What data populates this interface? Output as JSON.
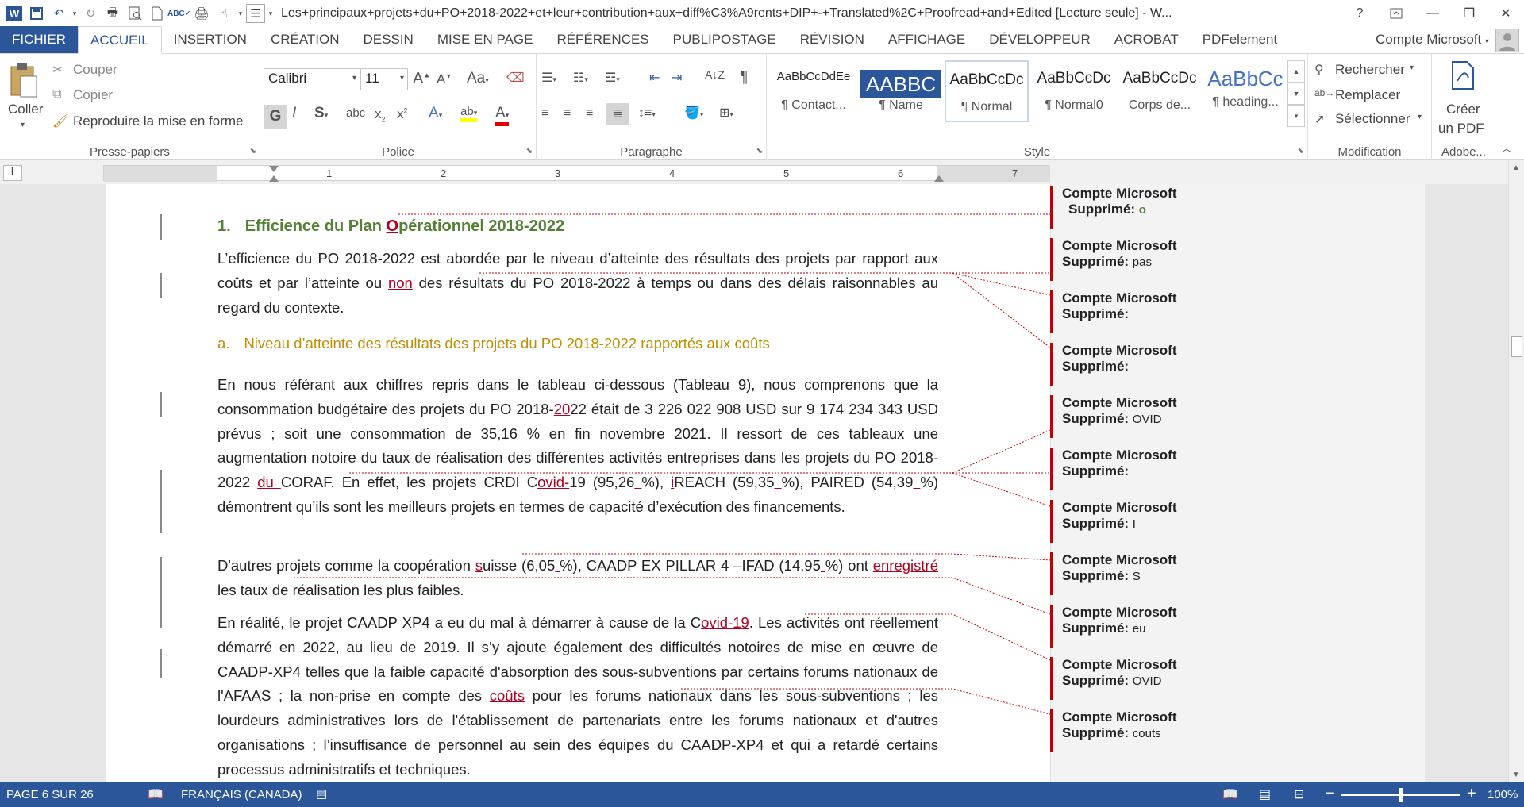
{
  "titlebar": {
    "title": "Les+principaux+projets+du+PO+2018-2022+et+leur+contribution+aux+diff%C3%A9rents+DIP+-+Translated%2C+Proofread+and+Edited [Lecture seule] - W...",
    "help": "?",
    "icons": [
      "word-logo-icon",
      "save-icon",
      "undo-icon",
      "redo-icon",
      "print-icon",
      "preview-icon",
      "new-doc-icon",
      "spelling-icon",
      "print-layout-icon",
      "touch-icon",
      "customize-icon",
      "layout-icon"
    ]
  },
  "tabs": [
    {
      "label": "FICHIER",
      "key": "fichier"
    },
    {
      "label": "ACCUEIL",
      "key": "accueil"
    },
    {
      "label": "INSERTION",
      "key": "insertion"
    },
    {
      "label": "CRÉATION",
      "key": "creation"
    },
    {
      "label": "DESSIN",
      "key": "dessin"
    },
    {
      "label": "MISE EN PAGE",
      "key": "mise-en-page"
    },
    {
      "label": "RÉFÉRENCES",
      "key": "references"
    },
    {
      "label": "PUBLIPOSTAGE",
      "key": "publipostage"
    },
    {
      "label": "RÉVISION",
      "key": "revision"
    },
    {
      "label": "AFFICHAGE",
      "key": "affichage"
    },
    {
      "label": "DÉVELOPPEUR",
      "key": "developpeur"
    },
    {
      "label": "ACROBAT",
      "key": "acrobat"
    },
    {
      "label": "PDFelement",
      "key": "pdfelement"
    }
  ],
  "account": "Compte Microsoft",
  "ribbon": {
    "clipboard": {
      "paste": "Coller",
      "cut": "Couper",
      "copy": "Copier",
      "format_painter": "Reproduire la mise en forme",
      "label": "Presse-papiers"
    },
    "font": {
      "family": "Calibri",
      "size": "11",
      "label": "Police",
      "case": "Aa"
    },
    "paragraph": {
      "label": "Paragraphe"
    },
    "styles": {
      "label": "Style",
      "items": [
        {
          "preview": "AaBbCcDdEe",
          "name": "¶ Contact..."
        },
        {
          "preview": "AABBC",
          "name": "¶ Name"
        },
        {
          "preview": "AaBbCcDc",
          "name": "¶ Normal"
        },
        {
          "preview": "AaBbCcDc",
          "name": "¶ Normal0"
        },
        {
          "preview": "AaBbCcDc",
          "name": "Corps de..."
        },
        {
          "preview": "AaBbCc",
          "name": "¶ heading..."
        }
      ]
    },
    "editing": {
      "find": "Rechercher",
      "replace": "Remplacer",
      "select": "Sélectionner",
      "label": "Modification"
    },
    "adobe": {
      "create_line1": "Créer",
      "create_line2": "un PDF",
      "label": "Adobe..."
    }
  },
  "ruler": {
    "numbers": [
      "1",
      "2",
      "3",
      "4",
      "5",
      "6",
      "7"
    ]
  },
  "document": {
    "heading1": {
      "num": "1.",
      "pre": "Efficience du Plan ",
      "ins": "O",
      "post": "pérationnel 2018-2022"
    },
    "p1": {
      "a": "L’efficience du PO 2018-2022 est abordée par le niveau d’atteinte des résultats des projets par rapport aux coûts et par l’atteinte ou ",
      "ins": "non",
      "b": " des résultats du PO 2018-2022 à temps ou dans des délais raisonnables au regard du contexte."
    },
    "heading2": {
      "num": "a.",
      "text": "Niveau d’atteinte des résultats des projets du PO 2018-2022 rapportés aux coûts"
    },
    "p2": {
      "a": "En nous référant aux chiffres repris dans le tableau ci-dessous (Tableau 9), nous comprenons que la consommation budgétaire des projets du PO 2018-",
      "ins1": "20",
      "b": "22 était de 3 226 022 908 USD sur 9 174 234 343 USD prévus ; soit une consommation de 35,16",
      "ins2": " ",
      "c": "% en fin novembre 2021. Il ressort de ces tableaux une augmentation notoire du taux de réalisation des différentes activités entreprises dans les projets du PO 2018-2022 ",
      "ins3": "du ",
      "d": "CORAF. En effet, les projets CRDI C",
      "ins4": "ovid-",
      "e": "19 (95,26",
      "ins5": " ",
      "f": "%), ",
      "ins6": "i",
      "g": "REACH (59,35",
      "ins7": " ",
      "h": "%), PAIRED (54,39",
      "ins8": " ",
      "i": "%) démontrent qu’ils sont les meilleurs projets en termes de capacité d’exécution des financements."
    },
    "p3": {
      "a": "D'autres projets comme la coopération ",
      "ins1": "s",
      "b": "uisse (6,05",
      "ins2": " ",
      "c": "%), CAADP EX PILLAR 4 –IFAD (14,95",
      "ins3": " ",
      "d": "%) ont ",
      "ins4": "enregistré",
      "e": " les taux de réalisation les plus faibles."
    },
    "p4": {
      "a": "En réalité, le projet CAADP XP4 a eu du mal à démarrer à cause de la C",
      "ins1": "ovid-19",
      "b": ". Les activités ont réellement démarré en 2022, au lieu de 2019. Il s’y ajoute également des difficultés notoires de mise en œuvre de CAADP-XP4 telles que la faible capacité d'absorption des sous-subventions par certains forums nationaux de l'AFAAS ; la non-prise en compte des ",
      "ins2": "coûts",
      "c": " pour les forums nationaux dans les sous-subventions ; les lourdeurs administratives lors de l'établissement de partenariats entre les forums nationaux et d'autres organisations ; l’insuffisance de personnel au sein des équipes du CAADP-XP4 et qui a retardé certains processus administratifs et techniques."
    }
  },
  "comments": [
    {
      "author": "Compte Microsoft",
      "label": "Supprimé:",
      "value": "o"
    },
    {
      "author": "Compte Microsoft",
      "label": "Supprimé:",
      "value": "pas"
    },
    {
      "author": "Compte Microsoft",
      "label": "Supprimé:",
      "value": ""
    },
    {
      "author": "Compte Microsoft",
      "label": "Supprimé:",
      "value": ""
    },
    {
      "author": "Compte Microsoft",
      "label": "Supprimé:",
      "value": "OVID"
    },
    {
      "author": "Compte Microsoft",
      "label": "Supprimé:",
      "value": ""
    },
    {
      "author": "Compte Microsoft",
      "label": "Supprimé:",
      "value": "I"
    },
    {
      "author": "Compte Microsoft",
      "label": "Supprimé:",
      "value": "S"
    },
    {
      "author": "Compte Microsoft",
      "label": "Supprimé:",
      "value": "eu"
    },
    {
      "author": "Compte Microsoft",
      "label": "Supprimé:",
      "value": "OVID"
    },
    {
      "author": "Compte Microsoft",
      "label": "Supprimé:",
      "value": "couts"
    }
  ],
  "status": {
    "page": "PAGE 6 SUR 26",
    "language": "FRANÇAIS (CANADA)",
    "zoom": "100%",
    "zoom_minus": "−",
    "zoom_plus": "+"
  },
  "colors": {
    "accent": "#2b579a",
    "insertion": "#b00020",
    "heading1": "#538135",
    "heading2": "#bf8f00",
    "balloon_bar": "#c00000"
  }
}
